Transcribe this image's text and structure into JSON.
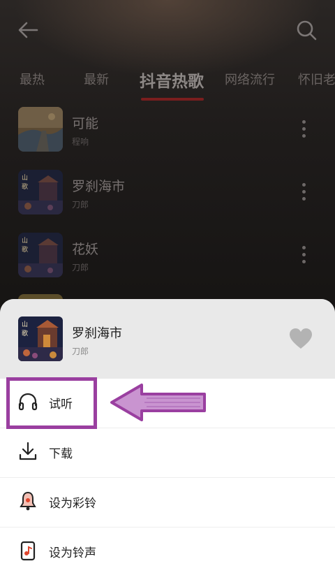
{
  "header": {
    "back_icon": "arrow-left-icon",
    "search_icon": "search-icon"
  },
  "tabs": [
    "最热",
    "最新",
    "抖音热歌",
    "网络流行",
    "怀旧老"
  ],
  "active_tab_index": 2,
  "songs": [
    {
      "title": "可能",
      "artist": "程响"
    },
    {
      "title": "罗刹海市",
      "artist": "刀郎"
    },
    {
      "title": "花妖",
      "artist": "刀郎"
    }
  ],
  "sheet": {
    "title": "罗刹海市",
    "artist": "刀郎",
    "favorite_icon": "heart-icon",
    "menu": [
      {
        "label": "试听",
        "icon": "headphones-icon"
      },
      {
        "label": "下载",
        "icon": "download-icon"
      },
      {
        "label": "设为彩铃",
        "icon": "bell-icon"
      },
      {
        "label": "设为铃声",
        "icon": "phone-ringtone-icon"
      }
    ]
  },
  "colors": {
    "accent_underline": "#7a1e1e",
    "annotation": "#9a3fa0"
  }
}
